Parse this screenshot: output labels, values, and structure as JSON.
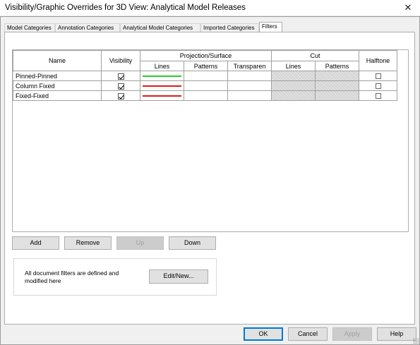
{
  "window": {
    "title": "Visibility/Graphic Overrides for 3D View: Analytical Model Releases",
    "close_glyph": "✕"
  },
  "tabs": [
    {
      "label": "Model Categories",
      "active": false
    },
    {
      "label": "Annotation Categories",
      "active": false
    },
    {
      "label": "Analytical Model Categories",
      "active": false
    },
    {
      "label": "Imported Categories",
      "active": false
    },
    {
      "label": "Filters",
      "active": true
    }
  ],
  "filters_table": {
    "headers": {
      "name": "Name",
      "visibility": "Visibility",
      "projection_surface": "Projection/Surface",
      "cut": "Cut",
      "halftone": "Halftone",
      "proj_lines": "Lines",
      "proj_patterns": "Patterns",
      "proj_transparency": "Transparen",
      "cut_lines": "Lines",
      "cut_patterns": "Patterns"
    },
    "rows": [
      {
        "name": "Pinned-Pinned",
        "visible": true,
        "line_color": "#2cc92c",
        "halftone": false
      },
      {
        "name": "Column Fixed",
        "visible": true,
        "line_color": "#e01a1a",
        "halftone": false
      },
      {
        "name": "Fixed-Fixed",
        "visible": true,
        "line_color": "#e01a1a",
        "halftone": false
      }
    ]
  },
  "row_buttons": {
    "add": "Add",
    "remove": "Remove",
    "up": "Up",
    "down": "Down"
  },
  "edit_group": {
    "description": "All document filters are defined and modified here",
    "edit_new_label": "Edit/New..."
  },
  "footer_buttons": {
    "ok": "OK",
    "cancel": "Cancel",
    "apply": "Apply",
    "help": "Help"
  }
}
